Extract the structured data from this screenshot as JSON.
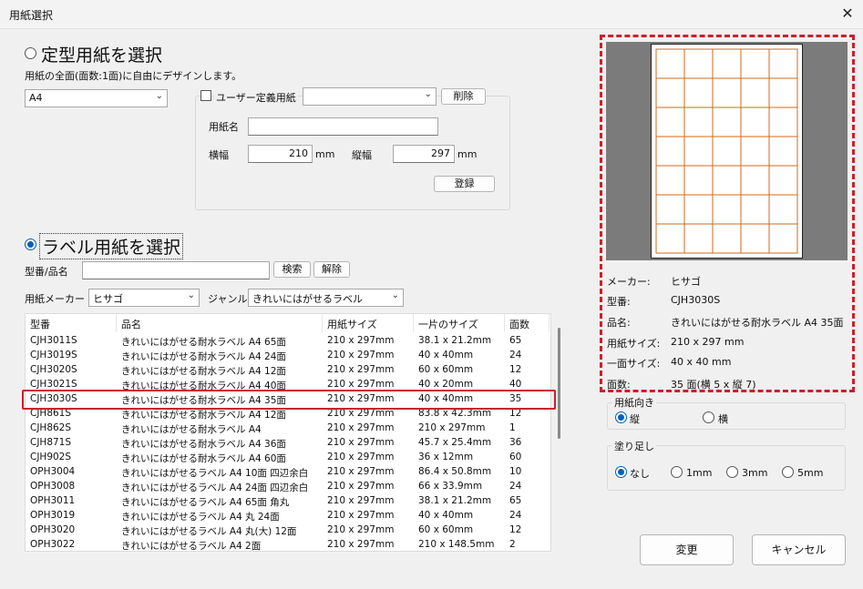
{
  "window": {
    "title": "用紙選択",
    "close_glyph": "✕"
  },
  "standard": {
    "radio_label": "定型用紙を選択",
    "description": "用紙の全面(面数:1面)に自由にデザインします。",
    "size_value": "A4",
    "user_defined_label": "ユーザー定義用紙",
    "user_defined_value": "",
    "delete_label": "削除",
    "paper_name_label": "用紙名",
    "paper_name_value": "",
    "width_label": "横幅",
    "width_value": "210",
    "height_label": "縦幅",
    "height_value": "297",
    "unit": "mm",
    "register_label": "登録"
  },
  "label": {
    "radio_label": "ラベル用紙を選択",
    "search_label": "型番/品名",
    "search_value": "",
    "search_button": "検索",
    "clear_button": "解除",
    "maker_label": "用紙メーカー",
    "maker_value": "ヒサゴ",
    "genre_label": "ジャンル",
    "genre_value": "きれいにはがせるラベル"
  },
  "table": {
    "headers": [
      "型番",
      "品名",
      "用紙サイズ",
      "一片のサイズ",
      "面数"
    ],
    "rows": [
      [
        "CJH3011S",
        "きれいにはがせる耐水ラベル A4 65面",
        "210 x 297mm",
        "38.1 x 21.2mm",
        "65"
      ],
      [
        "CJH3019S",
        "きれいにはがせる耐水ラベル A4 24面",
        "210 x 297mm",
        "40 x 40mm",
        "24"
      ],
      [
        "CJH3020S",
        "きれいにはがせる耐水ラベル A4 12面",
        "210 x 297mm",
        "60 x 60mm",
        "12"
      ],
      [
        "CJH3021S",
        "きれいにはがせる耐水ラベル A4 40面",
        "210 x 297mm",
        "40 x 20mm",
        "40"
      ],
      [
        "CJH3030S",
        "きれいにはがせる耐水ラベル A4 35面",
        "210 x 297mm",
        "40 x 40mm",
        "35"
      ],
      [
        "CJH861S",
        "きれいにはがせる耐水ラベル A4 12面",
        "210 x 297mm",
        "83.8 x 42.3mm",
        "12"
      ],
      [
        "CJH862S",
        "きれいにはがせる耐水ラベル A4",
        "210 x 297mm",
        "210 x 297mm",
        "1"
      ],
      [
        "CJH871S",
        "きれいにはがせる耐水ラベル A4 36面",
        "210 x 297mm",
        "45.7 x 25.4mm",
        "36"
      ],
      [
        "CJH902S",
        "きれいにはがせる耐水ラベル A4 60面",
        "210 x 297mm",
        "36 x 12mm",
        "60"
      ],
      [
        "OPH3004",
        "きれいにはがせるラベル A4 10面 四辺余白",
        "210 x 297mm",
        "86.4 x 50.8mm",
        "10"
      ],
      [
        "OPH3008",
        "きれいにはがせるラベル A4 24面 四辺余白",
        "210 x 297mm",
        "66 x 33.9mm",
        "24"
      ],
      [
        "OPH3011",
        "きれいにはがせるラベル A4 65面 角丸",
        "210 x 297mm",
        "38.1 x 21.2mm",
        "65"
      ],
      [
        "OPH3019",
        "きれいにはがせるラベル A4 丸 24面",
        "210 x 297mm",
        "40 x 40mm",
        "24"
      ],
      [
        "OPH3020",
        "きれいにはがせるラベル A4 丸(大) 12面",
        "210 x 297mm",
        "60 x 60mm",
        "12"
      ],
      [
        "OPH3022",
        "きれいにはがせるラベル A4 2面",
        "210 x 297mm",
        "210 x 148.5mm",
        "2"
      ]
    ],
    "selected_index": 4
  },
  "info": {
    "maker_label": "メーカー:",
    "maker_value": "ヒサゴ",
    "model_label": "型番:",
    "model_value": "CJH3030S",
    "name_label": "品名:",
    "name_value": "きれいにはがせる耐水ラベル A4 35面",
    "size_label": "用紙サイズ:",
    "size_value": "210 x 297 mm",
    "piece_label": "一面サイズ:",
    "piece_value": "40 x 40 mm",
    "count_label": "面数:",
    "count_value": "35 面(横 5 x 縦 7)"
  },
  "preview": {
    "columns": 5,
    "rows": 7,
    "grid_color": "#d2691e"
  },
  "orientation": {
    "label": "用紙向き",
    "portrait": "縦",
    "landscape": "横"
  },
  "bleed": {
    "label": "塗り足し",
    "options": [
      "なし",
      "1mm",
      "3mm",
      "5mm"
    ]
  },
  "buttons": {
    "ok": "変更",
    "cancel": "キャンセル"
  },
  "colors": {
    "accent": "#005fb8",
    "highlight": "#cc1f2b"
  }
}
